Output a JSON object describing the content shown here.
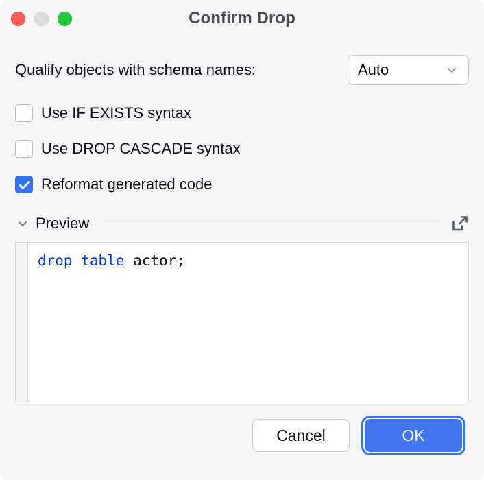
{
  "window": {
    "title": "Confirm Drop",
    "traffic_lights": [
      {
        "name": "close",
        "color": "#ff5f57"
      },
      {
        "name": "minimize",
        "color": "#dededf"
      },
      {
        "name": "zoom",
        "color": "#27c840"
      }
    ],
    "background": "#f4f5f7"
  },
  "schema_row": {
    "label": "Qualify objects with schema names:",
    "dropdown": {
      "value": "Auto",
      "icon": "chevron-down-icon"
    }
  },
  "checkboxes": [
    {
      "label": "Use IF EXISTS syntax",
      "checked": false
    },
    {
      "label": "Use DROP CASCADE syntax",
      "checked": false
    },
    {
      "label": "Reformat generated code",
      "checked": true
    }
  ],
  "preview": {
    "title": "Preview",
    "collapse_icon": "chevron-down-icon",
    "expand_icon": "open-in-new-window-icon",
    "expanded": true,
    "code": {
      "keyword": "drop table",
      "rest": " actor;",
      "keyword_color": "#0a36c8",
      "text_color": "#0b0b0d"
    }
  },
  "footer": {
    "cancel_label": "Cancel",
    "ok_label": "OK",
    "accent": "#3574f0"
  }
}
